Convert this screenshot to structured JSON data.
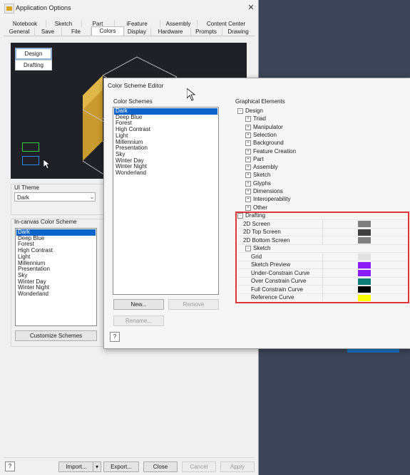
{
  "app_window": {
    "title": "Application Options",
    "close_glyph": "✕",
    "tabs_row1": [
      "Notebook",
      "Sketch",
      "Part",
      "iFeature",
      "Assembly",
      "Content Center"
    ],
    "tabs_row2": [
      "General",
      "Save",
      "File",
      "Colors",
      "Display",
      "Hardware",
      "Prompts",
      "Drawing"
    ],
    "selected_tab": "Colors",
    "preview": {
      "design_label": "Design",
      "drafting_label": "Drafting"
    },
    "ui_theme": {
      "label": "UI Theme",
      "value": "Dark"
    },
    "incanvas": {
      "label": "In-canvas Color Scheme",
      "items": [
        "Dark",
        "Deep Blue",
        "Forest",
        "High Contrast",
        "Light",
        "Millennium",
        "Presentation",
        "Sky",
        "Winter Day",
        "Winter Night",
        "Wonderland"
      ],
      "selected": "Dark"
    },
    "customize_label": "Customize Schemes",
    "footer": {
      "help": "?",
      "import": "Import...",
      "export": "Export...",
      "close": "Close",
      "cancel": "Cancel",
      "apply": "Apply"
    }
  },
  "color_scheme_editor": {
    "title": "Color Scheme Editor",
    "schemes_label": "Color Schemes",
    "schemes": [
      "Dark",
      "Deep Blue",
      "Forest",
      "High Contrast",
      "Light",
      "Millennium",
      "Presentation",
      "Sky",
      "Winter Day",
      "Winter Night",
      "Wonderland"
    ],
    "selected_scheme": "Dark",
    "new_label": "New...",
    "remove_label": "Remove",
    "rename_label": "Rename...",
    "help": "?",
    "graphical_elements_label": "Graphical Elements",
    "design": {
      "label": "Design",
      "children": [
        "Triad",
        "Manipulator",
        "Selection",
        "Background",
        "Feature Creation",
        "Part",
        "Assembly",
        "Sketch",
        "Glyphs",
        "Dimensions",
        "Interoperability",
        "Other"
      ]
    },
    "drafting": {
      "label": "Drafting",
      "items": [
        {
          "label": "2D Screen",
          "color": "#7f7f7f"
        },
        {
          "label": "2D Top Screen",
          "color": "#404040"
        },
        {
          "label": "2D Bottom Screen",
          "color": "#808080"
        }
      ],
      "sketch": {
        "label": "Sketch",
        "items": [
          {
            "label": "Grid",
            "color": "#e0e0e0"
          },
          {
            "label": "Sketch Preview",
            "color": "#8a1cf5"
          },
          {
            "label": "Under-Constrain Curve",
            "color": "#8a1cf5"
          },
          {
            "label": "Over Constrain Curve",
            "color": "#0f7f7a"
          },
          {
            "label": "Full Constrain Curve",
            "color": "#000000"
          },
          {
            "label": "Reference Curve",
            "color": "#ffff00"
          }
        ]
      }
    },
    "expand_glyph": "+",
    "collapse_glyph": "−",
    "highlight_color": "#e0363a"
  }
}
